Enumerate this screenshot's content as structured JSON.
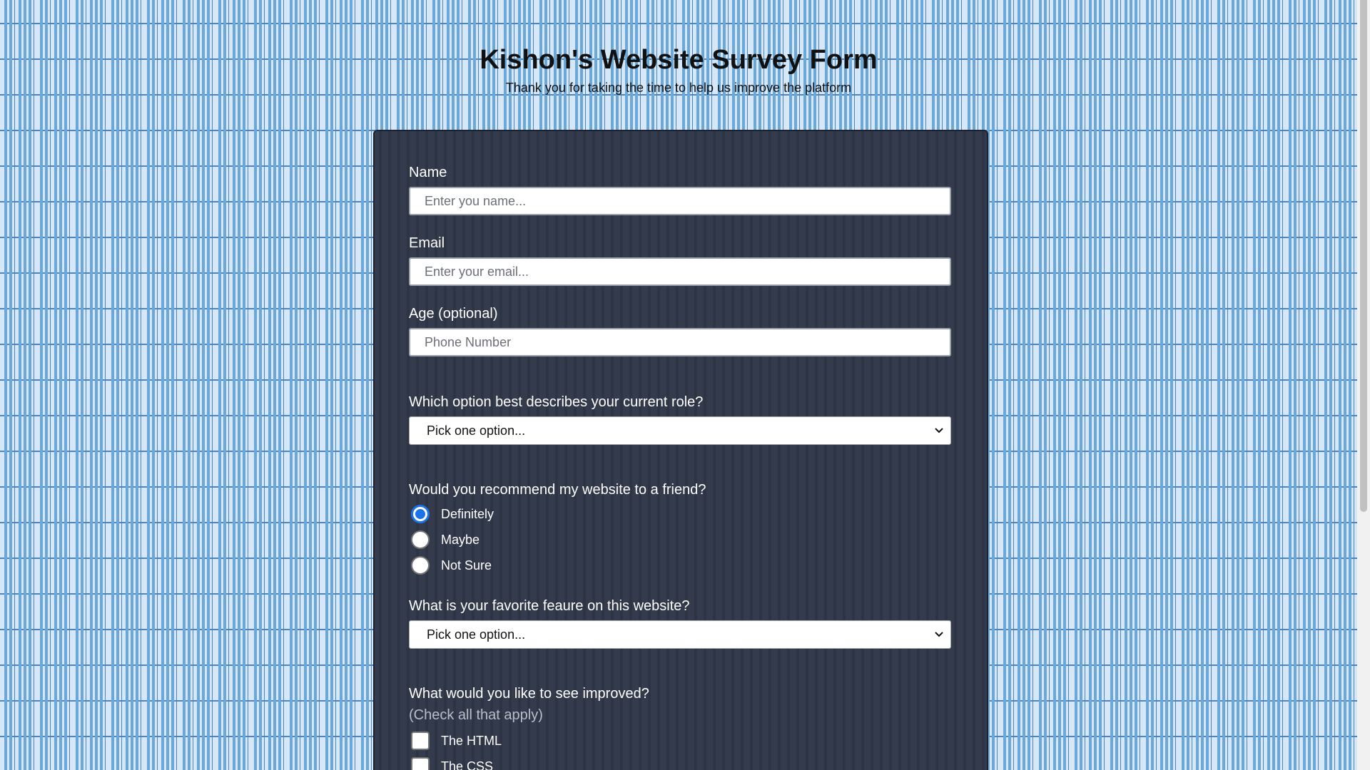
{
  "header": {
    "title": "Kishon's Website Survey Form",
    "subtitle": "Thank you for taking the time to help us improve the platform"
  },
  "form": {
    "name": {
      "label": "Name",
      "placeholder": "Enter you name...",
      "value": ""
    },
    "email": {
      "label": "Email",
      "placeholder": "Enter your email...",
      "value": ""
    },
    "age": {
      "label": "Age (optional)",
      "placeholder": "Phone Number",
      "value": ""
    },
    "role": {
      "label": "Which option best describes your current role?",
      "selected": "Pick one option..."
    },
    "recommend": {
      "label": "Would you recommend my website to a friend?",
      "options": [
        {
          "label": "Definitely",
          "checked": true
        },
        {
          "label": "Maybe",
          "checked": false
        },
        {
          "label": "Not Sure",
          "checked": false
        }
      ]
    },
    "feature": {
      "label": "What is your favorite feaure on this website?",
      "selected": "Pick one option..."
    },
    "improve": {
      "label": "What would you like to see improved?",
      "hint": "(Check all that apply)",
      "options": [
        {
          "label": "The HTML",
          "checked": false
        },
        {
          "label": "The CSS",
          "checked": false
        }
      ]
    }
  },
  "colors": {
    "card_background": "#2f3748",
    "radio_accent": "#1a73e8",
    "page_background": "#d6e8f7"
  },
  "icons": {
    "select_arrow": "chevron-down-icon"
  }
}
